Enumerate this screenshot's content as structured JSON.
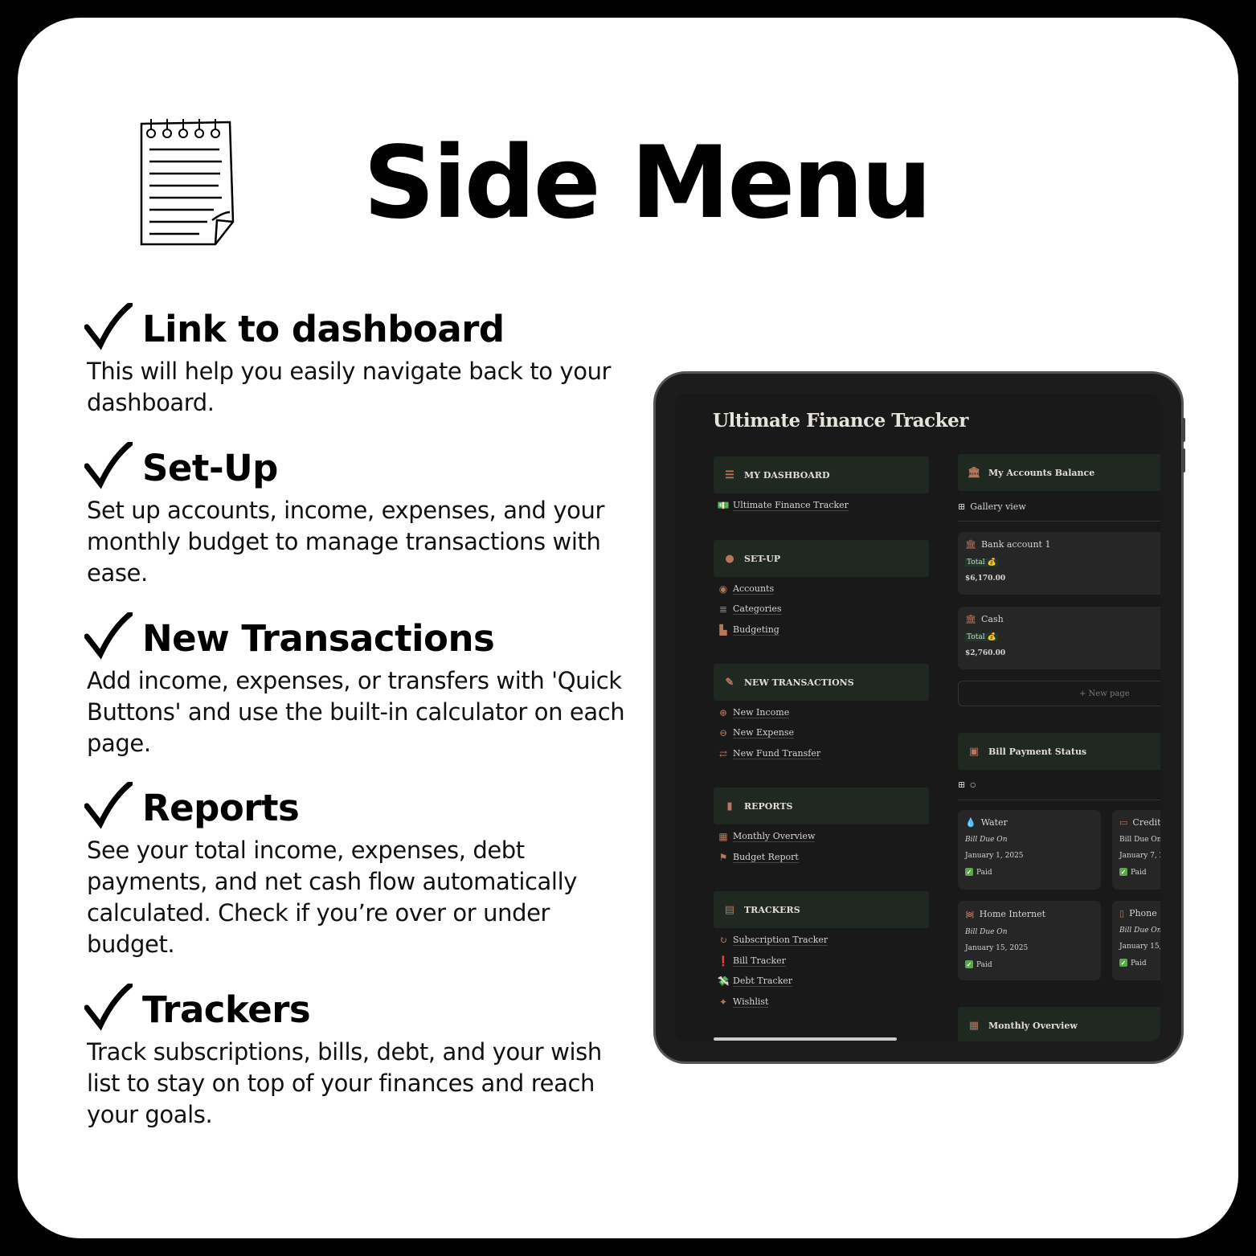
{
  "header": {
    "title": "Side Menu",
    "icon": "notepad-icon"
  },
  "features": [
    {
      "heading": "Link to dashboard",
      "body": "This will help you easily navigate back to your dashboard."
    },
    {
      "heading": "Set-Up",
      "body": "Set up accounts, income, expenses, and your monthly budget to manage transactions with ease."
    },
    {
      "heading": "New Transactions",
      "body": "Add income, expenses, or transfers with 'Quick Buttons' and use the built-in calculator on each page."
    },
    {
      "heading": "Reports",
      "body": "See your total income, expenses, debt payments, and net cash flow automatically calculated. Check if you’re over or under budget."
    },
    {
      "heading": "Trackers",
      "body": "Track subscriptions, bills, debt, and your wish list to stay on top of your finances and reach your goals."
    }
  ],
  "app": {
    "title": "Ultimate Finance Tracker",
    "accent": "#b9765c",
    "sections": [
      {
        "label": "MY DASHBOARD",
        "items": [
          "Ultimate Finance Tracker"
        ]
      },
      {
        "label": "SET-UP",
        "items": [
          "Accounts",
          "Categories",
          "Budgeting"
        ]
      },
      {
        "label": "NEW TRANSACTIONS",
        "items": [
          "New Income",
          "New Expense",
          "New Fund Transfer"
        ]
      },
      {
        "label": "REPORTS",
        "items": [
          "Monthly Overview",
          "Budget Report"
        ]
      },
      {
        "label": "TRACKERS",
        "items": [
          "Subscription Tracker",
          "Bill Tracker",
          "Debt Tracker",
          "Wishlist"
        ]
      }
    ],
    "accounts": {
      "title": "My Accounts Balance",
      "view": "Gallery view",
      "new_page": "+ New page",
      "cards": [
        {
          "name": "Bank account 1",
          "total_label": "Total 💰",
          "amount": "$6,170.00"
        },
        {
          "name": "Cash",
          "total_label": "Total 💰",
          "amount": "$2,760.00"
        }
      ]
    },
    "bills": {
      "title": "Bill Payment Status",
      "view_suffix": "○",
      "cards": [
        {
          "name": "Water",
          "due_label": "Bill Due On",
          "date": "January 1, 2025",
          "status": "Paid"
        },
        {
          "name": "Credit",
          "due_label": "Bill Due On",
          "date": "January 7, 20",
          "status": "Paid"
        },
        {
          "name": "Home Internet",
          "due_label": "Bill Due On",
          "date": "January 15, 2025",
          "status": "Paid"
        },
        {
          "name": "Phone",
          "due_label": "Bill Due On",
          "date": "January 15, 2",
          "status": "Paid"
        }
      ]
    },
    "monthly": {
      "title": "Monthly Overview"
    }
  }
}
